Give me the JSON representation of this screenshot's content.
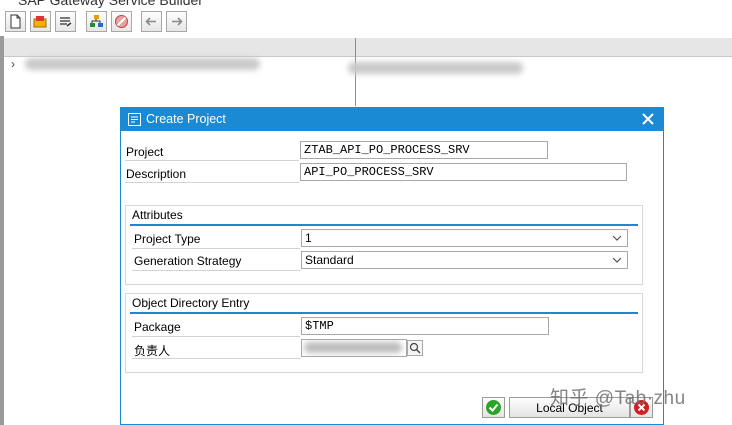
{
  "app": {
    "title": "SAP Gateway Service Builder"
  },
  "toolbar": {
    "buttons": [
      {
        "icon": "new-document-icon"
      },
      {
        "icon": "open-folder-icon"
      },
      {
        "icon": "redefine-icon"
      },
      {
        "icon": "model-icon"
      },
      {
        "icon": "disabled-icon"
      },
      {
        "icon": "back-arrow-icon"
      },
      {
        "icon": "forward-arrow-icon"
      }
    ]
  },
  "dialog": {
    "title": "Create Project",
    "project_label": "Project",
    "project_value": "ZTAB_API_PO_PROCESS_SRV",
    "description_label": "Description",
    "description_value": "API_PO_PROCESS_SRV",
    "attributes": {
      "title": "Attributes",
      "project_type_label": "Project Type",
      "project_type_value": "1",
      "generation_strategy_label": "Generation Strategy",
      "generation_strategy_value": "Standard"
    },
    "object_directory": {
      "title": "Object Directory Entry",
      "package_label": "Package",
      "package_value": "$TMP",
      "owner_label": "负责人"
    },
    "buttons": {
      "confirm_icon": "check-icon",
      "local_object_label": "Local Object",
      "cancel_icon": "cancel-icon"
    }
  },
  "watermark": "知乎 @Tab·zhu",
  "colors": {
    "accent": "#1a8ad4",
    "confirm": "#2aa52a",
    "cancel": "#d21e1e"
  }
}
